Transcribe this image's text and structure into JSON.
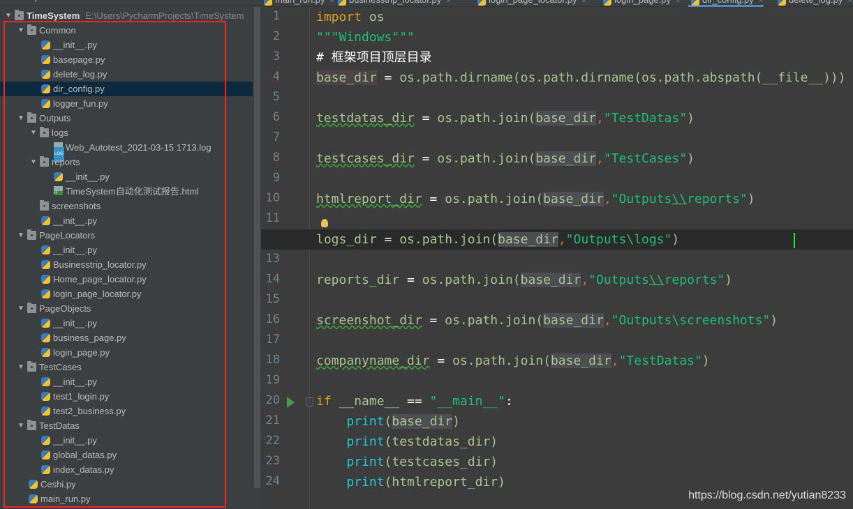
{
  "sidebar": {
    "title": "Project",
    "items": [
      {
        "label": "TimeSystem",
        "path": "E:\\Users\\PycharmProjects\\TimeSystem",
        "depth": 0,
        "type": "folder",
        "expanded": true
      },
      {
        "label": "Common",
        "depth": 1,
        "type": "folder",
        "expanded": true
      },
      {
        "label": "__init__.py",
        "depth": 2,
        "type": "py"
      },
      {
        "label": "basepage.py",
        "depth": 2,
        "type": "py"
      },
      {
        "label": "delete_log.py",
        "depth": 2,
        "type": "py"
      },
      {
        "label": "dir_config.py",
        "depth": 2,
        "type": "py",
        "selected": true
      },
      {
        "label": "logger_fun.py",
        "depth": 2,
        "type": "py"
      },
      {
        "label": "Outputs",
        "depth": 1,
        "type": "folder",
        "expanded": true
      },
      {
        "label": "logs",
        "depth": 2,
        "type": "folder",
        "expanded": true
      },
      {
        "label": "Web_Autotest_2021-03-15 1713.log",
        "depth": 3,
        "type": "log"
      },
      {
        "label": "reports",
        "depth": 2,
        "type": "folder",
        "expanded": true
      },
      {
        "label": "__init__.py",
        "depth": 3,
        "type": "py"
      },
      {
        "label": "TimeSystem自动化测试报告.html",
        "depth": 3,
        "type": "html"
      },
      {
        "label": "screenshots",
        "depth": 2,
        "type": "folder"
      },
      {
        "label": "__init__.py",
        "depth": 2,
        "type": "py"
      },
      {
        "label": "PageLocators",
        "depth": 1,
        "type": "folder",
        "expanded": true
      },
      {
        "label": "__init__.py",
        "depth": 2,
        "type": "py"
      },
      {
        "label": "Businesstrip_locator.py",
        "depth": 2,
        "type": "py"
      },
      {
        "label": "Home_page_locator.py",
        "depth": 2,
        "type": "py"
      },
      {
        "label": "login_page_locator.py",
        "depth": 2,
        "type": "py"
      },
      {
        "label": "PageObjects",
        "depth": 1,
        "type": "folder",
        "expanded": true
      },
      {
        "label": "__init__.py",
        "depth": 2,
        "type": "py"
      },
      {
        "label": "business_page.py",
        "depth": 2,
        "type": "py"
      },
      {
        "label": "login_page.py",
        "depth": 2,
        "type": "py"
      },
      {
        "label": "TestCases",
        "depth": 1,
        "type": "folder",
        "expanded": true
      },
      {
        "label": "__init__.py",
        "depth": 2,
        "type": "py"
      },
      {
        "label": "test1_login.py",
        "depth": 2,
        "type": "py"
      },
      {
        "label": "test2_business.py",
        "depth": 2,
        "type": "py"
      },
      {
        "label": "TestDatas",
        "depth": 1,
        "type": "folder",
        "expanded": true
      },
      {
        "label": "__init__.py",
        "depth": 2,
        "type": "py"
      },
      {
        "label": "global_datas.py",
        "depth": 2,
        "type": "py"
      },
      {
        "label": "index_datas.py",
        "depth": 2,
        "type": "py"
      },
      {
        "label": "Ceshi.py",
        "depth": 1,
        "type": "py"
      },
      {
        "label": "main_run.py",
        "depth": 1,
        "type": "py"
      }
    ]
  },
  "tabs": [
    {
      "label": "main_run.py"
    },
    {
      "label": "businesstrip_locator.py"
    },
    {
      "label": "login_page_locator.py"
    },
    {
      "label": "login_page.py"
    },
    {
      "label": "dir_config.py",
      "active": true
    },
    {
      "label": "delete_log.py"
    }
  ],
  "editor": {
    "current_line": 12,
    "lines": [
      [
        [
          "kw",
          "import "
        ],
        [
          "id",
          "os"
        ]
      ],
      [
        [
          "str",
          "\"\"\"Windows\"\"\""
        ]
      ],
      [
        [
          "cm",
          "# 框架项目顶层目录"
        ]
      ],
      [
        [
          "id hlr",
          "base_dir"
        ],
        [
          "op",
          " = "
        ],
        [
          "id",
          "os.path.dirname(os.path.dirname(os.path.abspath(__file__)))"
        ]
      ],
      [],
      [
        [
          "id warn",
          "testdatas_dir"
        ],
        [
          "op",
          " = "
        ],
        [
          "id",
          "os.path.join("
        ],
        [
          "id hl",
          "base_dir"
        ],
        [
          "cm2",
          ","
        ],
        [
          "str",
          "\"TestDatas\""
        ],
        [
          "id",
          ")"
        ]
      ],
      [],
      [
        [
          "id warn",
          "testcases_dir"
        ],
        [
          "op",
          " = "
        ],
        [
          "id",
          "os.path.join("
        ],
        [
          "id hl",
          "base_dir"
        ],
        [
          "cm2",
          ","
        ],
        [
          "str",
          "\"TestCases\""
        ],
        [
          "id",
          ")"
        ]
      ],
      [],
      [
        [
          "id warn",
          "htmlreport_dir"
        ],
        [
          "op",
          " = "
        ],
        [
          "id",
          "os.path.join("
        ],
        [
          "id hl",
          "base_dir"
        ],
        [
          "cm2",
          ","
        ],
        [
          "str",
          "\"Outputs"
        ],
        [
          "esc",
          "\\\\"
        ],
        [
          "str",
          "reports\""
        ],
        [
          "id",
          ")"
        ]
      ],
      [],
      [
        [
          "id",
          "logs_dir"
        ],
        [
          "op",
          " = "
        ],
        [
          "id",
          "os.path.join("
        ],
        [
          "id hl",
          "base_dir"
        ],
        [
          "cm2",
          ","
        ],
        [
          "str",
          "\"Outputs\\logs\""
        ],
        [
          "id",
          ")"
        ]
      ],
      [],
      [
        [
          "id",
          "reports_dir"
        ],
        [
          "op",
          " = "
        ],
        [
          "id",
          "os.path.join("
        ],
        [
          "id hl",
          "base_dir"
        ],
        [
          "cm2",
          ","
        ],
        [
          "str",
          "\"Outputs"
        ],
        [
          "esc",
          "\\\\"
        ],
        [
          "str",
          "reports\""
        ],
        [
          "id",
          ")"
        ]
      ],
      [],
      [
        [
          "id warn",
          "screenshot_dir"
        ],
        [
          "op",
          " = "
        ],
        [
          "id",
          "os.path.join("
        ],
        [
          "id hl",
          "base_dir"
        ],
        [
          "cm2",
          ","
        ],
        [
          "str",
          "\"Outputs\\screenshots\""
        ],
        [
          "id",
          ")"
        ]
      ],
      [],
      [
        [
          "id warn",
          "companyname_dir"
        ],
        [
          "op",
          " = "
        ],
        [
          "id",
          "os.path.join("
        ],
        [
          "id hl",
          "base_dir"
        ],
        [
          "cm2",
          ","
        ],
        [
          "str",
          "\"TestDatas\""
        ],
        [
          "id",
          ")"
        ]
      ],
      [],
      [
        [
          "kw",
          "if "
        ],
        [
          "id",
          "__name__"
        ],
        [
          "op",
          " == "
        ],
        [
          "str",
          "\"__main__\""
        ],
        [
          "op",
          ":"
        ]
      ],
      [
        [
          "id",
          "    "
        ],
        [
          "fn",
          "print"
        ],
        [
          "id",
          "("
        ],
        [
          "id hl",
          "base_dir"
        ],
        [
          "id",
          ")"
        ]
      ],
      [
        [
          "id",
          "    "
        ],
        [
          "fn",
          "print"
        ],
        [
          "id",
          "(testdatas_dir)"
        ]
      ],
      [
        [
          "id",
          "    "
        ],
        [
          "fn",
          "print"
        ],
        [
          "id",
          "(testcases_dir)"
        ]
      ],
      [
        [
          "id",
          "    "
        ],
        [
          "fn",
          "print"
        ],
        [
          "id",
          "(htmlreport_dir)"
        ]
      ]
    ]
  },
  "watermark": "https://blog.csdn.net/yutian8233"
}
